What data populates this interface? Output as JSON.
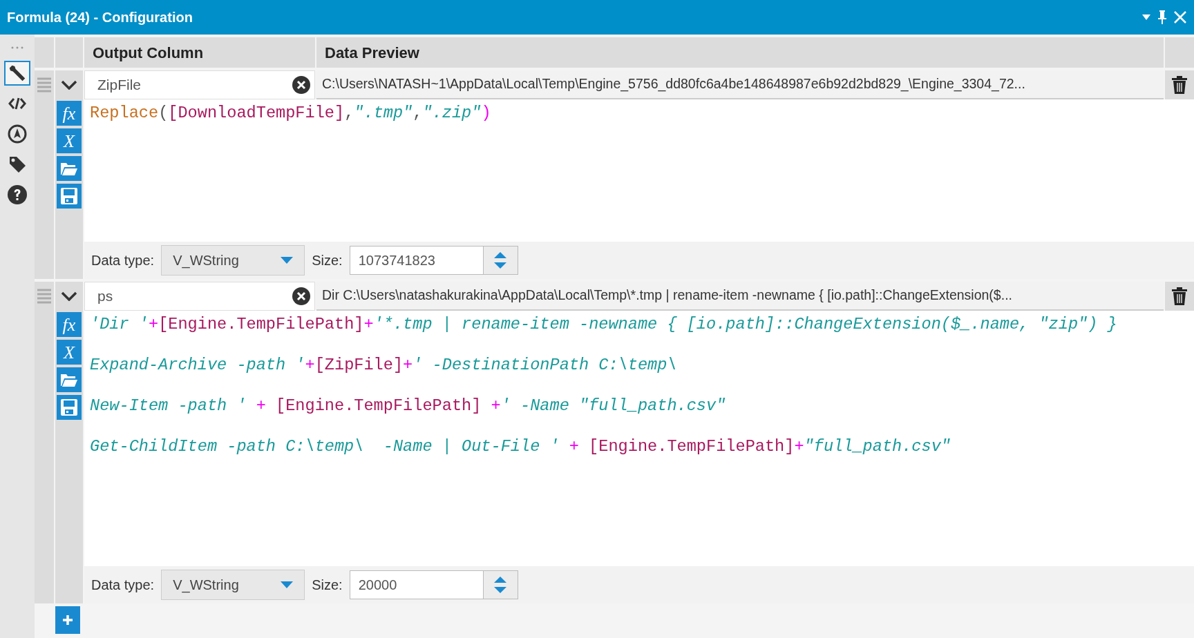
{
  "window": {
    "title": "Formula (24) - Configuration"
  },
  "sidebar": {
    "items": [
      {
        "selected": true
      },
      {
        "selected": false
      },
      {
        "selected": false
      },
      {
        "selected": false
      },
      {
        "selected": false
      }
    ]
  },
  "columns": [
    "Output Column",
    "Data Preview"
  ],
  "formulas": [
    {
      "expanded": true,
      "output_column": "ZipFile",
      "data_preview": "C:\\Users\\NATASH~1\\AppData\\Local\\Temp\\Engine_5756_dd80fc6a4be148648987e6b92d2bd829_\\Engine_3304_72...",
      "tool_glyphs": [
        "fx",
        "X"
      ],
      "code": [
        [
          {
            "kind": "function",
            "text": "Replace"
          },
          {
            "kind": "punct",
            "text": "("
          },
          {
            "kind": "field",
            "text": "[DownloadTempFile]"
          },
          {
            "kind": "punct",
            "text": ","
          },
          {
            "kind": "string",
            "text": "\".tmp\""
          },
          {
            "kind": "punct",
            "text": ","
          },
          {
            "kind": "string",
            "text": "\".zip\""
          },
          {
            "kind": "operator",
            "text": ")"
          }
        ]
      ],
      "data_type_label": "Data type:",
      "data_type": "V_WString",
      "size_label": "Size:",
      "size": "1073741823"
    },
    {
      "expanded": true,
      "output_column": "ps",
      "data_preview": "Dir C:\\Users\\natashakurakina\\AppData\\Local\\Temp\\*.tmp | rename-item -newname { [io.path]::ChangeExtension($...",
      "tool_glyphs": [
        "fx",
        "X"
      ],
      "code": [
        [
          {
            "kind": "string",
            "text": "'Dir '"
          },
          {
            "kind": "operator",
            "text": "+"
          },
          {
            "kind": "field",
            "text": "[Engine.TempFilePath]"
          },
          {
            "kind": "operator",
            "text": "+"
          },
          {
            "kind": "string",
            "text": "'*.tmp | rename-item -newname { [io.path]::ChangeExtension($_.name, \"zip\") }"
          }
        ],
        [
          {
            "kind": "string",
            "text": "Expand-Archive -path '"
          },
          {
            "kind": "operator",
            "text": "+"
          },
          {
            "kind": "field",
            "text": "[ZipFile]"
          },
          {
            "kind": "operator",
            "text": "+"
          },
          {
            "kind": "string",
            "text": "' -DestinationPath C:\\temp\\"
          }
        ],
        [
          {
            "kind": "string",
            "text": "New-Item -path ' "
          },
          {
            "kind": "operator",
            "text": "+ "
          },
          {
            "kind": "field",
            "text": "[Engine.TempFilePath]"
          },
          {
            "kind": "operator",
            "text": " +"
          },
          {
            "kind": "string",
            "text": "' -Name \"full_path.csv\""
          }
        ],
        [
          {
            "kind": "string",
            "text": "Get-ChildItem -path C:\\temp\\  -Name | Out-File ' "
          },
          {
            "kind": "operator",
            "text": "+ "
          },
          {
            "kind": "field",
            "text": "[Engine.TempFilePath]"
          },
          {
            "kind": "operator",
            "text": "+"
          },
          {
            "kind": "string",
            "text": "\"full_path.csv\""
          }
        ]
      ],
      "data_type_label": "Data type:",
      "data_type": "V_WString",
      "size_label": "Size:",
      "size": "20000"
    }
  ]
}
